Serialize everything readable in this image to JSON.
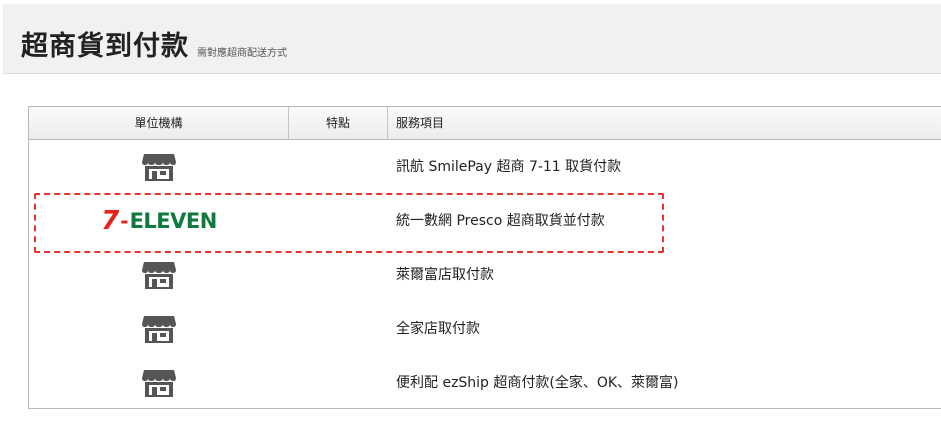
{
  "header": {
    "title": "超商貨到付款",
    "subtitle": "需對應超商配送方式"
  },
  "table": {
    "columns": [
      "單位機構",
      "特點",
      "服務項目"
    ],
    "rows": [
      {
        "logo": "store-icon",
        "service": "訊航 SmilePay 超商 7-11 取貨付款"
      },
      {
        "logo": "7-eleven-logo",
        "service": "統一數網 Presco 超商取貨並付款"
      },
      {
        "logo": "store-icon",
        "service": "萊爾富店取付款"
      },
      {
        "logo": "store-icon",
        "service": "全家店取付款"
      },
      {
        "logo": "store-icon",
        "service": "便利配 ezShip 超商付款(全家、OK、萊爾富)"
      }
    ]
  },
  "seven_eleven_logo": {
    "seven": "7",
    "dash": "-",
    "eleven": "ELEVEN"
  },
  "colors": {
    "highlight": "#e8342c",
    "seven_red": "#e32219",
    "seven_green": "#0e7a3d",
    "icon_gray": "#555555"
  }
}
